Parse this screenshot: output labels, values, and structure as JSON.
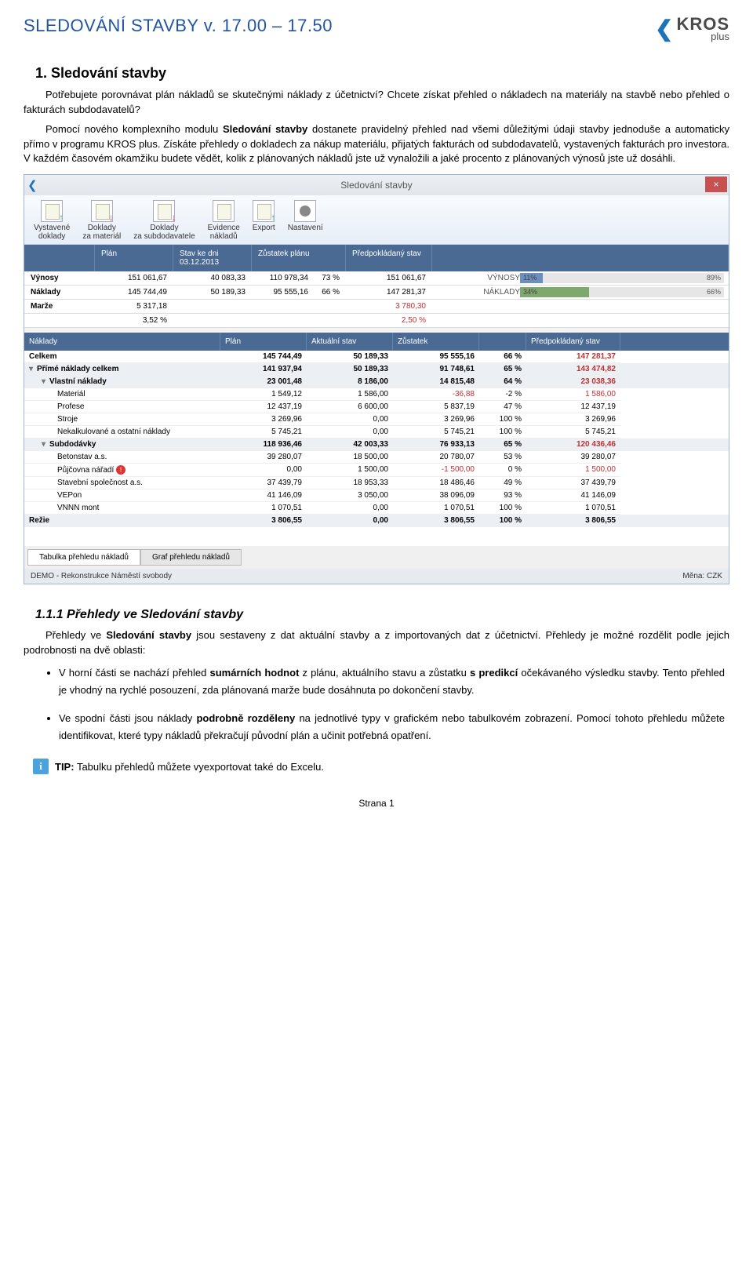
{
  "doc": {
    "title_full": "SLEDOVÁNÍ STAVBY v. 17.00 – 17.50",
    "logo_main": "KROS",
    "logo_sub": "plus"
  },
  "s1": {
    "heading": "1. Sledování stavby",
    "p1": "Potřebujete porovnávat plán nákladů se skutečnými náklady z účetnictví? Chcete získat přehled o nákladech na materiály na stavbě nebo přehled o fakturách subdodavatelů?",
    "p2a": "Pomocí nového komplexního modulu ",
    "p2b": "Sledování stavby",
    "p2c": " dostanete pravidelný přehled nad všemi důležitými údaji stavby jednoduše a automaticky přímo v programu KROS plus. Získáte přehledy o dokladech za nákup materiálu, přijatých fakturách od subdodavatelů, vystavených fakturách pro investora. V každém časovém okamžiku budete vědět, kolik z plánovaných nákladů jste už vynaložili a jaké procento z plánovaných výnosů jste už dosáhli."
  },
  "app": {
    "title": "Sledování stavby",
    "toolbar": [
      {
        "label": "Vystavené\ndoklady"
      },
      {
        "label": "Doklady\nza materiál"
      },
      {
        "label": "Doklady\nza subdodavatele"
      },
      {
        "label": "Evidence\nnákladů"
      },
      {
        "label": "Export"
      },
      {
        "label": "Nastavení"
      }
    ],
    "sum_hdr": {
      "plan": "Plán",
      "stav": "Stav ke dni 03.12.2013",
      "zust": "Zůstatek plánu",
      "pred": "Předpokládaný stav"
    },
    "sum_rows": [
      {
        "label": "Výnosy",
        "plan": "151 061,67",
        "stav": "40 083,33",
        "zust": "110 978,34",
        "pct": "73 %",
        "pred": "151 061,67"
      },
      {
        "label": "Náklady",
        "plan": "145 744,49",
        "stav": "50 189,33",
        "zust": "95 555,16",
        "pct": "66 %",
        "pred": "147 281,37"
      },
      {
        "label": "Marže",
        "plan": "5 317,18",
        "stav": "",
        "zust": "",
        "pct": "",
        "pred": "3 780,30",
        "red": true
      },
      {
        "label": "",
        "plan": "3,52 %",
        "stav": "",
        "zust": "",
        "pct": "",
        "pred": "2,50 %",
        "red": true
      }
    ],
    "bars": [
      {
        "label": "VÝNOSY",
        "pct": 11,
        "rest": 89
      },
      {
        "label": "NÁKLADY",
        "pct": 34,
        "rest": 66
      }
    ],
    "nak_hdr": {
      "c1": "Náklady",
      "c2": "Plán",
      "c3": "Aktuální stav",
      "c4": "Zůstatek",
      "c5": "",
      "c6": "Předpokládaný stav"
    },
    "costs": {
      "celkem": {
        "label": "Celkem",
        "plan": "145 744,49",
        "akt": "50 189,33",
        "zust": "95 555,16",
        "pct": "66 %",
        "pred": "147 281,37"
      },
      "prime": {
        "label": "Přímé náklady celkem",
        "plan": "141 937,94",
        "akt": "50 189,33",
        "zust": "91 748,61",
        "pct": "65 %",
        "pred": "143 474,82"
      },
      "vlastni": {
        "label": "Vlastní náklady",
        "plan": "23 001,48",
        "akt": "8 186,00",
        "zust": "14 815,48",
        "pct": "64 %",
        "pred": "23 038,36"
      },
      "material": {
        "label": "Materiál",
        "plan": "1 549,12",
        "akt": "1 586,00",
        "zust": "-36,88",
        "zust_red": true,
        "pct": "-2 %",
        "pred": "1 586,00"
      },
      "profese": {
        "label": "Profese",
        "plan": "12 437,19",
        "akt": "6 600,00",
        "zust": "5 837,19",
        "pct": "47 %",
        "pred": "12 437,19"
      },
      "stroje": {
        "label": "Stroje",
        "plan": "3 269,96",
        "akt": "0,00",
        "zust": "3 269,96",
        "pct": "100 %",
        "pred": "3 269,96"
      },
      "nekalk": {
        "label": "Nekalkulované a ostatní náklady",
        "plan": "5 745,21",
        "akt": "0,00",
        "zust": "5 745,21",
        "pct": "100 %",
        "pred": "5 745,21"
      },
      "subdod": {
        "label": "Subdodávky",
        "plan": "118 936,46",
        "akt": "42 003,33",
        "zust": "76 933,13",
        "pct": "65 %",
        "pred": "120 436,46"
      },
      "betonstav": {
        "label": "Betonstav a.s.",
        "plan": "39 280,07",
        "akt": "18 500,00",
        "zust": "20 780,07",
        "pct": "53 %",
        "pred": "39 280,07"
      },
      "pujcovna": {
        "label": "Půjčovna nářadí",
        "plan": "0,00",
        "akt": "1 500,00",
        "zust": "-1 500,00",
        "zust_red": true,
        "pct": "0 %",
        "pred": "1 500,00",
        "warn": true
      },
      "stavebni": {
        "label": "Stavební společnost a.s.",
        "plan": "37 439,79",
        "akt": "18 953,33",
        "zust": "18 486,46",
        "pct": "49 %",
        "pred": "37 439,79"
      },
      "vepon": {
        "label": "VEPon",
        "plan": "41 146,09",
        "akt": "3 050,00",
        "zust": "38 096,09",
        "pct": "93 %",
        "pred": "41 146,09"
      },
      "vnnn": {
        "label": "VNNN mont",
        "plan": "1 070,51",
        "akt": "0,00",
        "zust": "1 070,51",
        "pct": "100 %",
        "pred": "1 070,51"
      },
      "rezie": {
        "label": "Režie",
        "plan": "3 806,55",
        "akt": "0,00",
        "zust": "3 806,55",
        "pct": "100 %",
        "pred": "3 806,55"
      }
    },
    "tabs": {
      "t1": "Tabulka přehledu nákladů",
      "t2": "Graf přehledu nákladů"
    },
    "status": {
      "left": "DEMO - Rekonstrukce Náměstí svobody",
      "right": "Měna: CZK"
    }
  },
  "s11": {
    "heading": "1.1.1 Přehledy ve Sledování stavby",
    "p1a": "Přehledy ve ",
    "p1b": "Sledování stavby",
    "p1c": " jsou sestaveny z dat aktuální stavby a z importovaných dat z účetnictví. Přehledy je možné rozdělit podle jejich podrobnosti na dvě oblasti:",
    "li1a": "V horní části se nachází přehled ",
    "li1b": "sumárních hodnot",
    "li1c": " z plánu, aktuálního stavu a zůstatku ",
    "li1d": "s predikcí",
    "li1e": " očekávaného výsledku stavby. Tento přehled je vhodný na rychlé posouzení, zda plánovaná marže bude dosáhnuta po dokončení stavby.",
    "li2a": "Ve spodní části jsou náklady ",
    "li2b": "podrobně rozděleny",
    "li2c": " na jednotlivé typy v grafickém nebo tabulkovém zobrazení. Pomocí tohoto přehledu můžete identifikovat, které typy nákladů překračují původní plán a učinit potřebná opatření.",
    "tip_label": "TIP:",
    "tip_text": " Tabulku přehledů můžete vyexportovat také do Excelu."
  },
  "footer": "Strana 1"
}
